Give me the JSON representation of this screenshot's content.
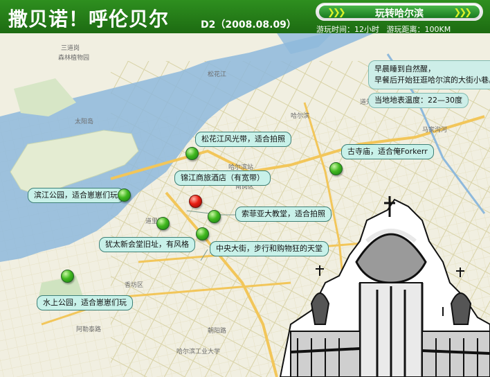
{
  "header": {
    "title": "撒贝诺！呼伦贝尔",
    "day": "D2（2008.08.09）",
    "banner": "玩转哈尔滨",
    "time_label": "游玩时间：",
    "time_value": "12小时",
    "distance_label": "游玩距离：",
    "distance_value": "100KM"
  },
  "notes": {
    "line1": "早晨睡到自然醒，",
    "line2": "早餐后开始狂逛哈尔滨的大街小巷。",
    "temperature": "当地地表温度：22—30度"
  },
  "spots": [
    {
      "label": "松花江风光带，适合拍照"
    },
    {
      "label": "古寺庙，适合俺Forkerr"
    },
    {
      "label": "锦江商旅酒店（有宽带）"
    },
    {
      "label": "滨江公园，适合崽崽们玩"
    },
    {
      "label": "索菲亚大教堂，适合拍照"
    },
    {
      "label": "犹太新会堂旧址，有风格"
    },
    {
      "label": "中央大街，步行和购物狂的天堂"
    },
    {
      "label": "水上公园，适合崽崽们玩"
    }
  ],
  "map_labels": [
    "三道岗",
    "森林植物园",
    "太阳岛",
    "哈尔滨",
    "松花江",
    "马家沟河",
    "道外区",
    "道里区",
    "南岗区",
    "香坊区",
    "哈尔滨工业大学",
    "哈尔滨站",
    "阿勒泰路",
    "朝阳路"
  ],
  "colors": {
    "header_green": "#2e8f1f",
    "callout_fill": "#c8f1e9",
    "river": "#8eb9dc",
    "pin_green": "#41b81f",
    "pin_red": "#e81d12"
  }
}
